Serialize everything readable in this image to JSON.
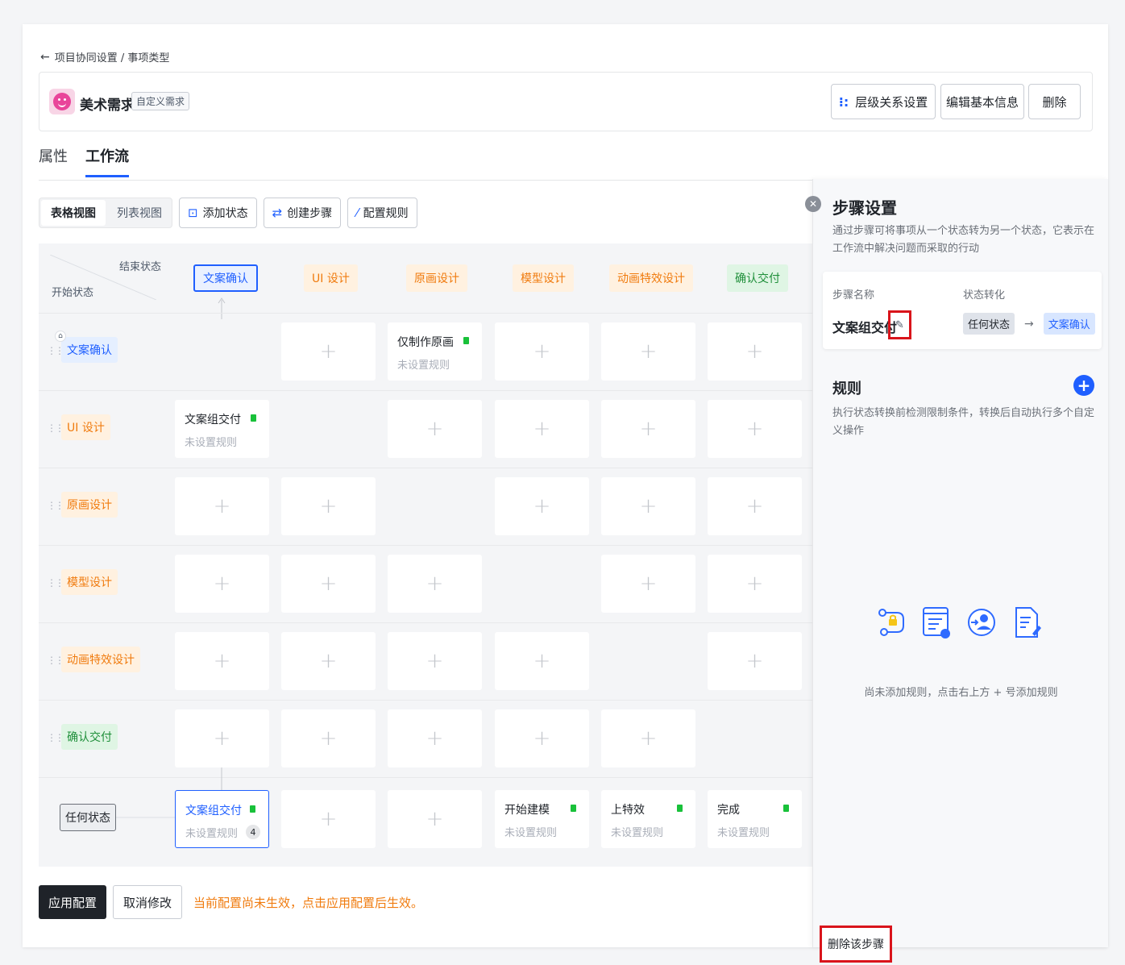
{
  "breadcrumb": {
    "text": "项目协同设置 / 事项类型"
  },
  "issue": {
    "title": "美术需求",
    "tag": "自定义需求"
  },
  "header_buttons": {
    "hierarchy": "层级关系设置",
    "edit_info": "编辑基本信息",
    "delete": "删除"
  },
  "tabs": [
    {
      "label": "属性"
    },
    {
      "label": "工作流"
    }
  ],
  "toolbar": {
    "table_view": "表格视图",
    "list_view": "列表视图",
    "add_state": "添加状态",
    "create_step": "创建步骤",
    "config_rules": "配置规则"
  },
  "grid": {
    "end_label": "结束状态",
    "start_label": "开始状态",
    "columns": [
      {
        "label": "文案确认",
        "color": "#1f5fff"
      },
      {
        "label": "UI 设计",
        "color": "#f07b0e"
      },
      {
        "label": "原画设计",
        "color": "#f07b0e"
      },
      {
        "label": "模型设计",
        "color": "#f07b0e"
      },
      {
        "label": "动画特效设计",
        "color": "#f07b0e"
      },
      {
        "label": "确认交付",
        "color": "#1f8f3a"
      }
    ],
    "rows": [
      {
        "label": "文案确认"
      },
      {
        "label": "UI 设计"
      },
      {
        "label": "原画设计"
      },
      {
        "label": "模型设计"
      },
      {
        "label": "动画特效设计"
      },
      {
        "label": "确认交付"
      }
    ],
    "steps": {
      "r0c2": {
        "name": "仅制作原画",
        "rule": "未设置规则"
      },
      "r1c0": {
        "name": "文案组交付",
        "rule": "未设置规则"
      },
      "any_c0": {
        "name": "文案组交付",
        "rule": "未设置规则",
        "count": "4"
      },
      "any_c3": {
        "name": "开始建模",
        "rule": "未设置规则"
      },
      "any_c4": {
        "name": "上特效",
        "rule": "未设置规则"
      },
      "any_c5": {
        "name": "完成",
        "rule": "未设置规则"
      }
    },
    "any_state": "任何状态"
  },
  "footer": {
    "apply": "应用配置",
    "cancel": "取消修改",
    "notice": "当前配置尚未生效，点击应用配置后生效。"
  },
  "panel": {
    "title": "步骤设置",
    "desc": "通过步骤可将事项从一个状态转为另一个状态，它表示在工作流中解决问题而采取的行动",
    "step_name_label": "步骤名称",
    "transition_label": "状态转化",
    "step_name": "文案组交付",
    "from": "任何状态",
    "to": "文案确认",
    "rules_title": "规则",
    "rules_desc": "执行状态转换前检测限制条件，转换后自动执行多个自定义操作",
    "empty_text": "尚未添加规则，点击右上方 + 号添加规则",
    "delete_step": "删除该步骤"
  }
}
